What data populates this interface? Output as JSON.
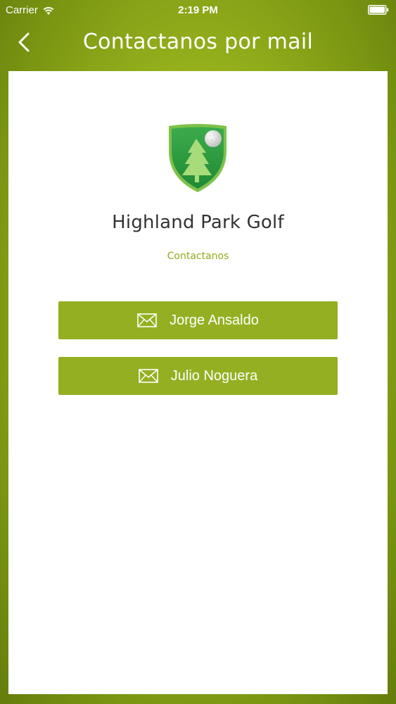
{
  "status_bar": {
    "carrier": "Carrier",
    "time": "2:19 PM"
  },
  "nav": {
    "title": "Contactanos por mail",
    "back_icon": "chevron-left-icon"
  },
  "club": {
    "name": "Highland Park Golf",
    "subtitle": "Contactanos",
    "logo_icon": "golf-shield-logo-icon"
  },
  "contacts": [
    {
      "label": "Jorge Ansaldo",
      "icon": "mail-icon"
    },
    {
      "label": "Julio Noguera",
      "icon": "mail-icon"
    }
  ],
  "colors": {
    "accent": "#94b022",
    "subtitle": "#8faa1c",
    "background_green": "#9ab51e",
    "text_dark": "#333333"
  }
}
